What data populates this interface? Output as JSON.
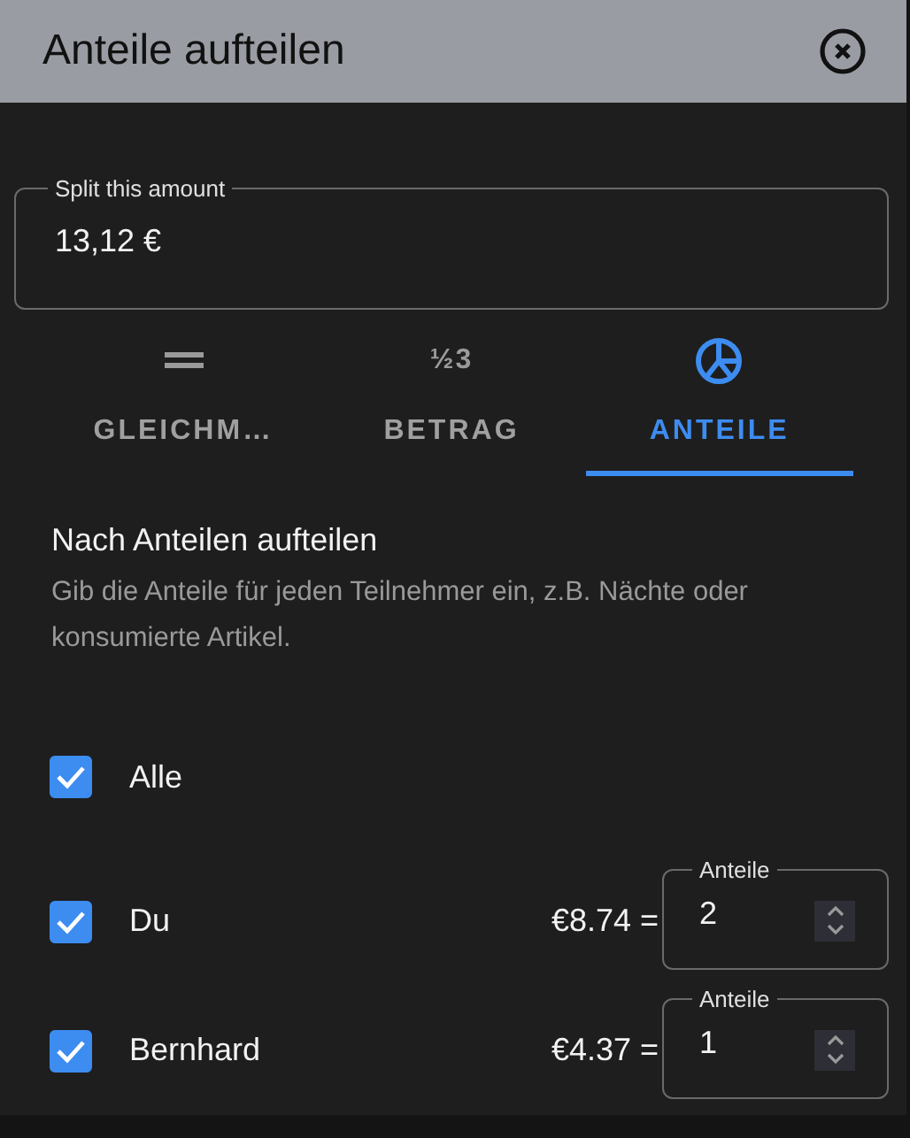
{
  "dialog": {
    "title": "Anteile aufteilen"
  },
  "amount_field": {
    "label": "Split this amount",
    "value": "13,12 €"
  },
  "tabs": [
    {
      "label": "GLEICHM…",
      "kind": "equals",
      "selected": false
    },
    {
      "label": "BETRAG",
      "kind": "numbers",
      "icon_text": "½3",
      "selected": false
    },
    {
      "label": "ANTEILE",
      "kind": "pie",
      "selected": true
    }
  ],
  "section": {
    "title": "Nach Anteilen aufteilen",
    "description": "Gib die Anteile für jeden Teilnehmer ein, z.B. Nächte oder konsumierte Artikel."
  },
  "participants": [
    {
      "name": "Alle",
      "checked": true
    },
    {
      "name": "Du",
      "checked": true,
      "amount": "€8.74 =",
      "shares_label": "Anteile",
      "shares": "2"
    },
    {
      "name": "Bernhard",
      "checked": true,
      "amount": "€4.37 =",
      "shares_label": "Anteile",
      "shares": "1"
    }
  ]
}
